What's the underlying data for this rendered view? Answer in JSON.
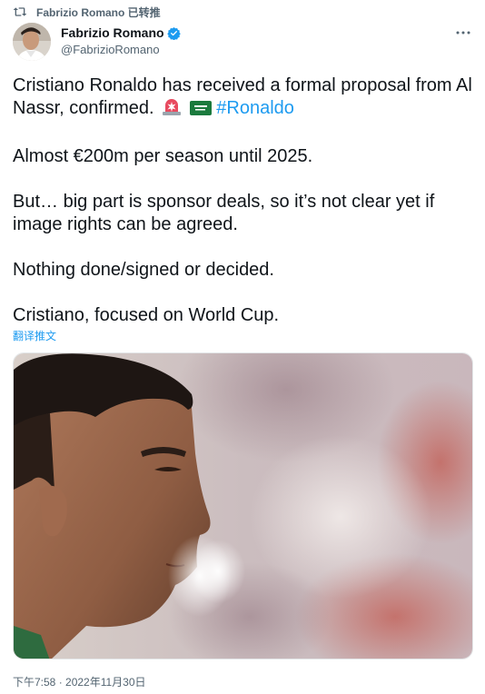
{
  "retweet": {
    "text": "Fabrizio Romano 已转推",
    "icon": "retweet-icon"
  },
  "author": {
    "name": "Fabrizio Romano",
    "handle": "@FabrizioRomano",
    "verified": true,
    "avatar_icon": "avatar"
  },
  "more": {
    "icon": "more-horizontal-icon"
  },
  "tweet": {
    "line1": "Cristiano Ronaldo has received a formal proposal from Al Nassr, confirmed.",
    "emojis": [
      "police-light-emoji",
      "saudi-arabia-flag-emoji"
    ],
    "hashtag": "#Ronaldo",
    "line2": "Almost €200m per season until 2025.",
    "line3": "But… big part is sponsor deals, so it’s not clear yet if image rights can be agreed.",
    "line4": "Nothing done/signed or decided.",
    "line5": "Cristiano, focused on World Cup."
  },
  "translate": {
    "label": "翻译推文"
  },
  "media": {
    "description": "photo"
  },
  "timestamp": {
    "text": "下午7:58 · 2022年11月30日"
  },
  "colors": {
    "accent": "#1d9bf0",
    "text_primary": "#0f1419",
    "text_secondary": "#536471"
  }
}
